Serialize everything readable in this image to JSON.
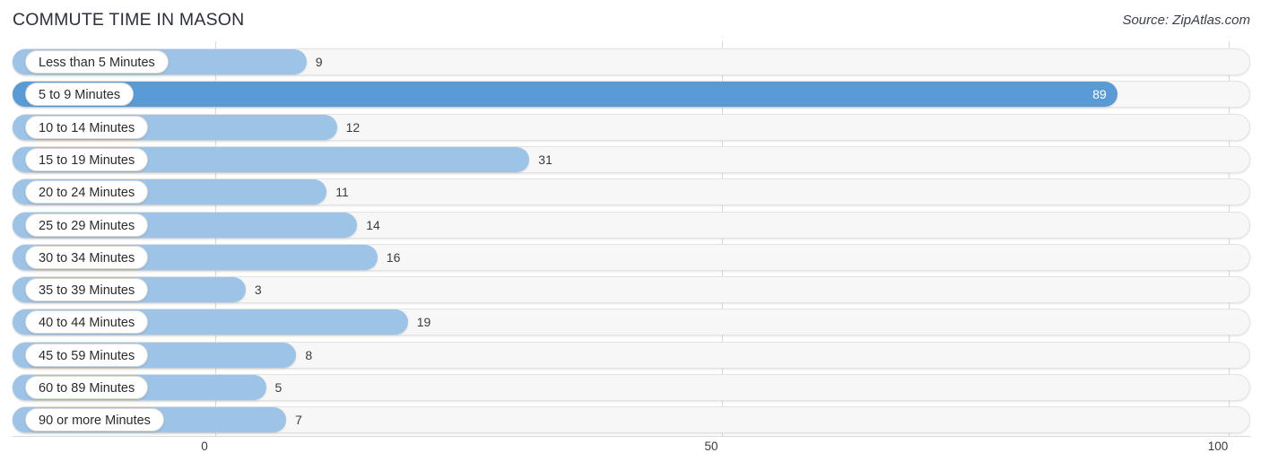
{
  "header": {
    "title": "COMMUTE TIME IN MASON",
    "source": "Source: ZipAtlas.com"
  },
  "chart_data": {
    "type": "bar",
    "orientation": "horizontal",
    "title": "COMMUTE TIME IN MASON",
    "xlabel": "",
    "ylabel": "",
    "xlim": [
      0,
      100
    ],
    "ticks": [
      "0",
      "50",
      "100"
    ],
    "tick_values": [
      0,
      50,
      100
    ],
    "grid": true,
    "legend": "none",
    "categories": [
      "Less than 5 Minutes",
      "5 to 9 Minutes",
      "10 to 14 Minutes",
      "15 to 19 Minutes",
      "20 to 24 Minutes",
      "25 to 29 Minutes",
      "30 to 34 Minutes",
      "35 to 39 Minutes",
      "40 to 44 Minutes",
      "45 to 59 Minutes",
      "60 to 89 Minutes",
      "90 or more Minutes"
    ],
    "values": [
      9,
      89,
      12,
      31,
      11,
      14,
      16,
      3,
      19,
      8,
      5,
      7
    ],
    "value_labels": [
      "9",
      "89",
      "12",
      "31",
      "11",
      "14",
      "16",
      "3",
      "19",
      "8",
      "5",
      "7"
    ],
    "colors": {
      "bar": "#9dc3e6",
      "bar_max": "#5b9bd5",
      "track": "#f7f7f7",
      "track_border": "#e3e3e3",
      "gridline": "#d8d8d8",
      "label_text": "#2b2b2b",
      "value_text": "#3b3b3b",
      "value_text_inside": "#ffffff"
    },
    "max_index": 1
  }
}
